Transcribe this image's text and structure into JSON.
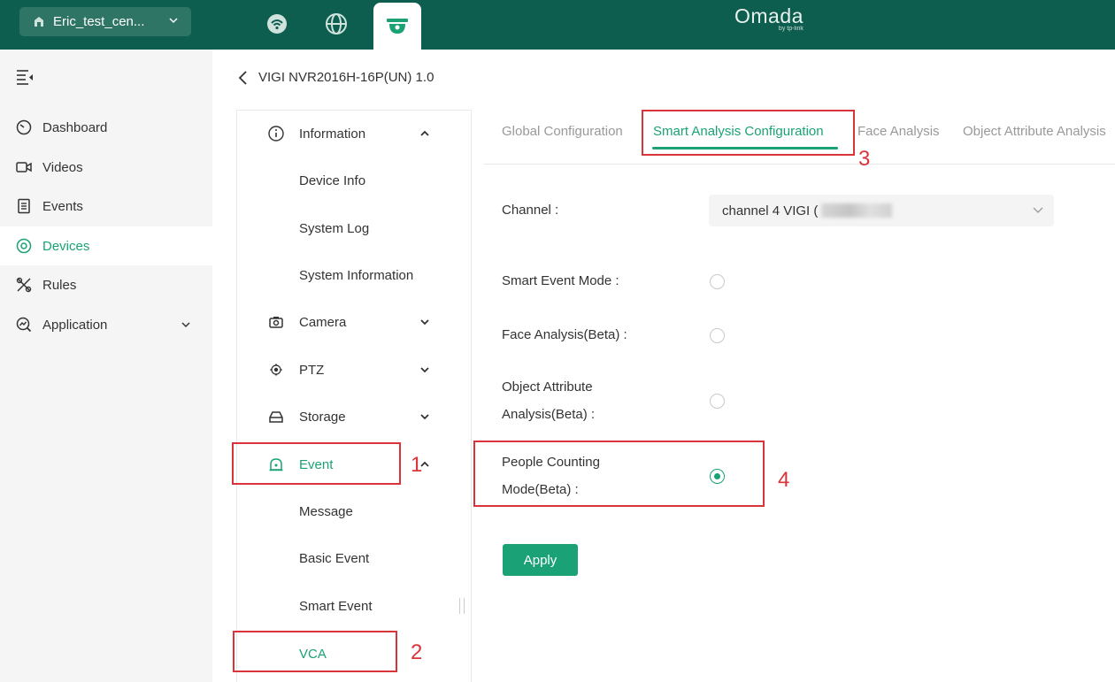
{
  "header": {
    "site_name": "Eric_test_cen...",
    "brand_name": "Omada",
    "brand_sub": "by tp-link",
    "nav_icons": [
      "wifi-router-icon",
      "globe-icon",
      "camera-dome-icon"
    ],
    "active_nav": "camera-dome-icon",
    "colors": {
      "header_bg": "#0e5e4f",
      "accent": "#1aa276",
      "annotation": "#d9343a"
    }
  },
  "sidebar": {
    "items": [
      {
        "label": "Dashboard",
        "icon": "gauge-icon"
      },
      {
        "label": "Videos",
        "icon": "video-icon"
      },
      {
        "label": "Events",
        "icon": "list-icon"
      },
      {
        "label": "Devices",
        "icon": "target-icon",
        "active": true
      },
      {
        "label": "Rules",
        "icon": "tools-icon"
      },
      {
        "label": "Application",
        "icon": "chart-search-icon"
      }
    ]
  },
  "page": {
    "device_title": "VIGI NVR2016H-16P(UN) 1.0"
  },
  "menu": {
    "information": "Information",
    "device_info": "Device Info",
    "system_log": "System Log",
    "system_information": "System Information",
    "camera": "Camera",
    "ptz": "PTZ",
    "storage": "Storage",
    "event": "Event",
    "message": "Message",
    "basic_event": "Basic Event",
    "smart_event": "Smart Event",
    "vca": "VCA"
  },
  "tabs": {
    "global": "Global Configuration",
    "smart": "Smart Analysis Configuration",
    "face": "Face Analysis",
    "object": "Object Attribute Analysis"
  },
  "form": {
    "channel_label": "Channel :",
    "channel_value": "channel 4 VIGI (",
    "smart_event_label": "Smart Event Mode :",
    "face_label": "Face Analysis(Beta) :",
    "object_label_1": "Object Attribute",
    "object_label_2": "Analysis(Beta) :",
    "people_label_1": "People Counting",
    "people_label_2": "Mode(Beta) :",
    "selected_mode": "People Counting Mode(Beta)",
    "apply": "Apply"
  },
  "annotations": [
    "1",
    "2",
    "3",
    "4"
  ]
}
